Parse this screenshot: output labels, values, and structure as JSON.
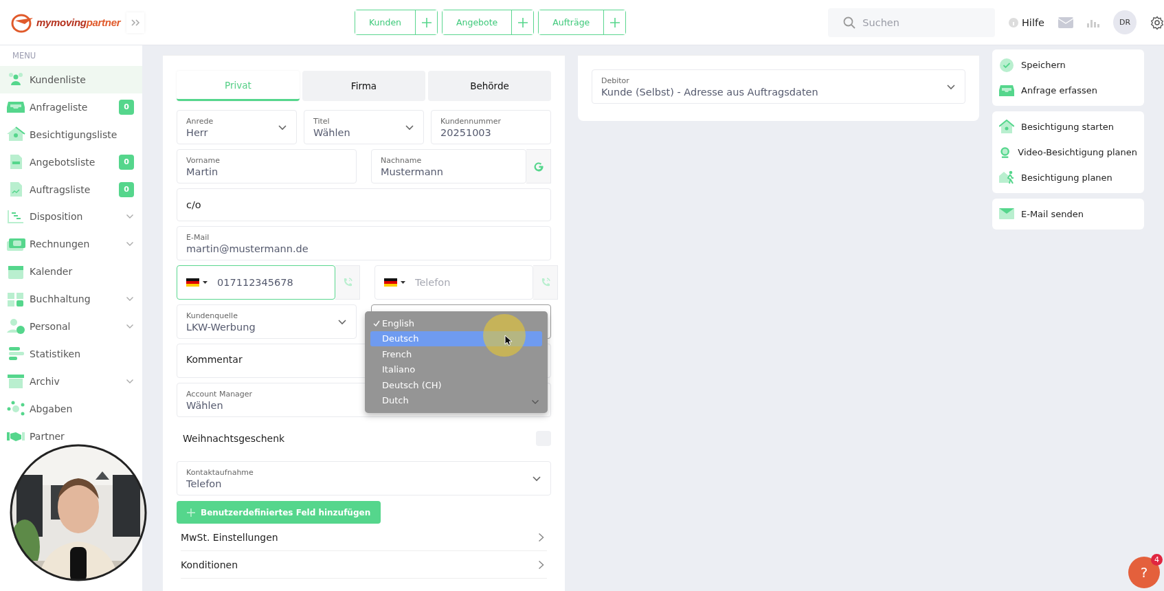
{
  "header": {
    "logo_primary": "mymoving",
    "logo_accent": "partner",
    "quick_actions": [
      {
        "label": "Kunden"
      },
      {
        "label": "Angebote"
      },
      {
        "label": "Aufträge"
      }
    ],
    "search": {
      "placeholder": "Suchen"
    },
    "help": "Hilfe",
    "avatar": "DR"
  },
  "sidebar": {
    "heading": "MENU",
    "items": [
      {
        "label": "Kundenliste",
        "selected": true,
        "expandable": false
      },
      {
        "label": "Anfrageliste",
        "selected": false,
        "expandable": false,
        "badge": "0"
      },
      {
        "label": "Besichtigungsliste",
        "selected": false,
        "expandable": false
      },
      {
        "label": "Angebotsliste",
        "selected": false,
        "expandable": false,
        "badge": "0"
      },
      {
        "label": "Auftragsliste",
        "selected": false,
        "expandable": false,
        "badge": "0"
      },
      {
        "label": "Disposition",
        "selected": false,
        "expandable": true
      },
      {
        "label": "Rechnungen",
        "selected": false,
        "expandable": true
      },
      {
        "label": "Kalender",
        "selected": false,
        "expandable": false
      },
      {
        "label": "Buchhaltung",
        "selected": false,
        "expandable": true
      },
      {
        "label": "Personal",
        "selected": false,
        "expandable": true
      },
      {
        "label": "Statistiken",
        "selected": false,
        "expandable": false
      },
      {
        "label": "Archiv",
        "selected": false,
        "expandable": true
      },
      {
        "label": "Abgaben",
        "selected": false,
        "expandable": false
      },
      {
        "label": "Partner",
        "selected": false,
        "expandable": false
      }
    ]
  },
  "form": {
    "tabs": [
      {
        "label": "Privat",
        "selected": true
      },
      {
        "label": "Firma",
        "selected": false
      },
      {
        "label": "Behörde",
        "selected": false
      }
    ],
    "rows": [
      [
        {
          "kind": "select",
          "label": "Anrede",
          "value": "Herr"
        },
        {
          "kind": "select",
          "label": "Titel",
          "value": "Wählen"
        },
        {
          "kind": "input",
          "label": "Kundennummer",
          "value": "20251003"
        }
      ],
      [
        {
          "kind": "input",
          "label": "Vorname",
          "value": "Martin"
        },
        {
          "kind": "input",
          "label": "Nachname",
          "value": "Mustermann",
          "addon": true
        }
      ],
      [
        {
          "kind": "plain",
          "placeholder": "c/o"
        }
      ],
      [
        {
          "kind": "input",
          "label": "E-Mail",
          "value": "martin@mustermann.de"
        }
      ],
      [
        {
          "kind": "phone",
          "value": "017112345678",
          "focused": true
        },
        {
          "kind": "phone",
          "placeholder": "Telefon",
          "focused": false
        }
      ],
      [
        {
          "kind": "select",
          "label": "Kundenquelle",
          "value": "LKW-Werbung"
        },
        {
          "kind": "language",
          "open": true
        }
      ],
      [
        {
          "kind": "textarea",
          "placeholder": "Kommentar"
        }
      ],
      [
        {
          "kind": "select",
          "label": "Account Manager",
          "value": "Wählen"
        }
      ]
    ],
    "checkbox": {
      "label": "Weihnachtsgeschenk",
      "checked": false
    },
    "contact": {
      "label": "Kontaktaufnahme",
      "value": "Telefon"
    },
    "add_button": "Benutzerdefiniertes Feld hinzufügen",
    "sections": [
      "MwSt. Einstellungen",
      "Konditionen"
    ]
  },
  "language_dropdown": {
    "options": [
      {
        "label": "English",
        "checked": true,
        "highlighted": false
      },
      {
        "label": "Deutsch",
        "checked": false,
        "highlighted": true
      },
      {
        "label": "French",
        "checked": false,
        "highlighted": false
      },
      {
        "label": "Italiano",
        "checked": false,
        "highlighted": false
      },
      {
        "label": "Deutsch (CH)",
        "checked": false,
        "highlighted": false
      },
      {
        "label": "Dutch",
        "checked": false,
        "highlighted": false
      }
    ]
  },
  "debitor": {
    "label": "Debitor",
    "value": "Kunde (Selbst) - Adresse aus Auftragsdaten"
  },
  "actions": [
    [
      "Speichern",
      "Anfrage erfassen"
    ],
    [
      "Besichtigung starten",
      "Video-Besichtigung planen",
      "Besichtigung planen"
    ],
    [
      "E-Mail senden"
    ]
  ],
  "webcam": {
    "kind": "picture"
  },
  "help_bubble": {
    "symbol": "?",
    "badge": "4"
  }
}
